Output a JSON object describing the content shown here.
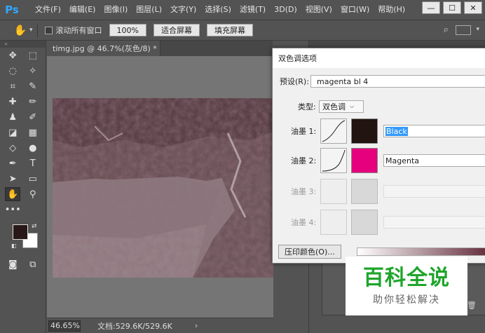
{
  "app": {
    "logo": "Ps"
  },
  "menus": [
    "文件(F)",
    "编辑(E)",
    "图像(I)",
    "图层(L)",
    "文字(Y)",
    "选择(S)",
    "滤镜(T)",
    "3D(D)",
    "视图(V)",
    "窗口(W)",
    "帮助(H)"
  ],
  "window_controls": {
    "minimize": "—",
    "maximize": "☐",
    "close": "✕"
  },
  "options_bar": {
    "scroll_all_label": "滚动所有窗口",
    "zoom_100": "100%",
    "fit_screen": "适合屏幕",
    "fill_screen": "填充屏幕",
    "tool_icon": "hand-icon"
  },
  "document": {
    "tab_title": "timg.jpg @ 46.7%(灰色/8) *",
    "tab_close": "×",
    "zoom": "46.65%",
    "doc_info": "文档:529.6K/529.6K",
    "status_arrow": "›"
  },
  "dialog": {
    "title": "双色调选项",
    "preset_label": "预设(R):",
    "preset_value": "magenta bl 4",
    "type_label": "类型:",
    "type_value": "双色调",
    "inks": [
      {
        "label": "油墨 1:",
        "name": "Black",
        "color": "#221410",
        "enabled": true
      },
      {
        "label": "油墨 2:",
        "name": "Magenta",
        "color": "#e6007e",
        "enabled": true
      },
      {
        "label": "油墨 3:",
        "name": "",
        "color": "",
        "enabled": false
      },
      {
        "label": "油墨 4:",
        "name": "",
        "color": "",
        "enabled": false
      }
    ],
    "overprint_button": "压印颜色(O)..."
  },
  "watermark": {
    "title": "百科全说",
    "subtitle": "助你轻松解决",
    "color": "#1ea52a"
  },
  "colors": {
    "foreground": "#2a1818",
    "background": "#ffffff",
    "accent": "#31a8ff"
  }
}
